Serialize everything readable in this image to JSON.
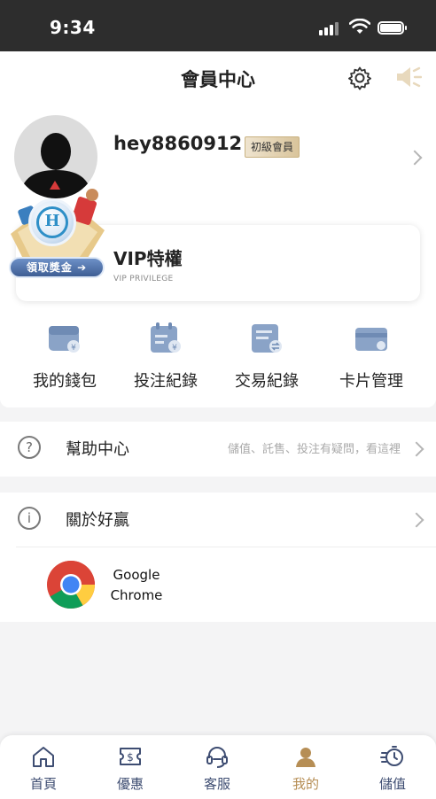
{
  "status_bar": {
    "time": "9:34"
  },
  "header": {
    "title": "會員中心"
  },
  "profile": {
    "username": "hey8860912",
    "level_badge": "初級會員",
    "promo_label": "領取獎金"
  },
  "vip": {
    "title": "VIP特權",
    "subtitle": "VIP PRIVILEGE"
  },
  "quick_menu": [
    {
      "label": "我的錢包",
      "icon": "wallet-icon"
    },
    {
      "label": "投注紀錄",
      "icon": "bet-record-icon"
    },
    {
      "label": "交易紀錄",
      "icon": "transaction-icon"
    },
    {
      "label": "卡片管理",
      "icon": "card-icon"
    }
  ],
  "help": {
    "label": "幫助中心",
    "hint": "儲值、託售、投注有疑問，看這裡"
  },
  "about": {
    "label": "關於好贏"
  },
  "chrome_app": {
    "line1": "Google",
    "line2": "Chrome"
  },
  "tabbar": [
    {
      "label": "首頁",
      "icon": "home-icon"
    },
    {
      "label": "優惠",
      "icon": "coupon-icon"
    },
    {
      "label": "客服",
      "icon": "headset-icon"
    },
    {
      "label": "我的",
      "icon": "profile-icon",
      "active": true
    },
    {
      "label": "儲值",
      "icon": "deposit-icon"
    }
  ],
  "colors": {
    "accent_gold": "#b68e55",
    "tab_text": "#3e4d72",
    "status_bar_bg": "#2d2d2d"
  }
}
